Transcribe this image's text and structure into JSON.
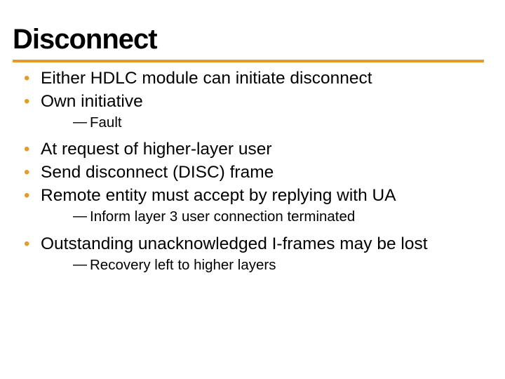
{
  "title": "Disconnect",
  "b1": "Either HDLC module can initiate disconnect",
  "b2": "Own initiative",
  "s2a": "Fault",
  "b3": "At request of higher-layer user",
  "b4": "Send disconnect (DISC) frame",
  "b5": "Remote entity must accept by replying with UA",
  "s5a": "Inform layer 3 user connection terminated",
  "b6": "Outstanding unacknowledged I-frames may be lost",
  "s6a": "Recovery left to higher layers"
}
